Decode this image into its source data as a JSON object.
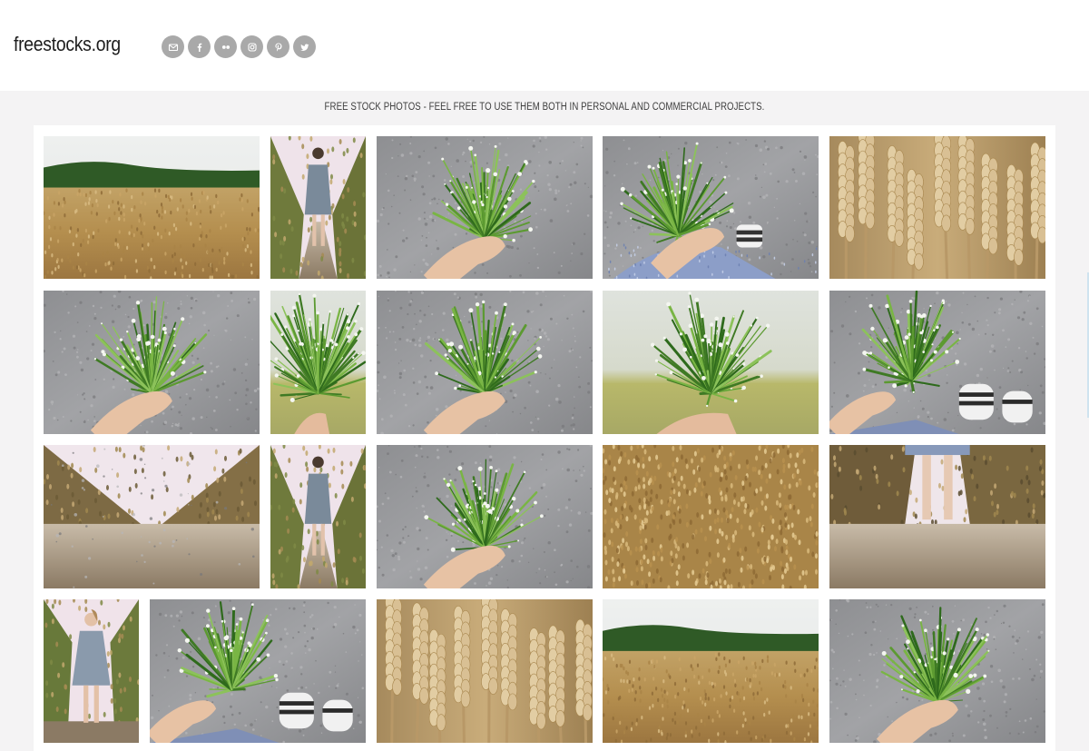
{
  "header": {
    "logo": "freestocks.org",
    "social": [
      {
        "icon": "mail-icon",
        "label": "Email"
      },
      {
        "icon": "facebook-icon",
        "label": "Facebook"
      },
      {
        "icon": "flickr-icon",
        "label": "Flickr"
      },
      {
        "icon": "instagram-icon",
        "label": "Instagram"
      },
      {
        "icon": "pinterest-icon",
        "label": "Pinterest"
      },
      {
        "icon": "twitter-icon",
        "label": "Twitter"
      }
    ]
  },
  "tagline": "FREE STOCK PHOTOS - FEEL FREE TO USE THEM BOTH IN PERSONAL AND COMMERCIAL PROJECTS.",
  "colors": {
    "page_bg": "#f4f3f4",
    "panel_bg": "#ffffff",
    "social_bg": "#a9a9a9"
  },
  "gallery": [
    {
      "subject": "wheat-field-landscape"
    },
    {
      "subject": "woman-walking-wheat-path"
    },
    {
      "subject": "hand-holding-wildflowers"
    },
    {
      "subject": "wildflowers-over-dress"
    },
    {
      "subject": "wheat-ears-closeup"
    },
    {
      "subject": "hand-holding-wildflowers"
    },
    {
      "subject": "wildflowers-against-sky"
    },
    {
      "subject": "hand-holding-wildflowers"
    },
    {
      "subject": "wildflowers-against-sky"
    },
    {
      "subject": "wildflowers-and-shoes"
    },
    {
      "subject": "wheat-path-ground-level"
    },
    {
      "subject": "woman-walking-wheat-path"
    },
    {
      "subject": "hand-holding-wildflowers"
    },
    {
      "subject": "wheat-ears-field"
    },
    {
      "subject": "legs-in-wheat-path"
    },
    {
      "subject": "woman-in-wheat-field"
    },
    {
      "subject": "wildflowers-and-shoes"
    },
    {
      "subject": "wheat-ears-closeup"
    },
    {
      "subject": "wheat-field-landscape"
    },
    {
      "subject": "hand-holding-wildflowers"
    }
  ]
}
